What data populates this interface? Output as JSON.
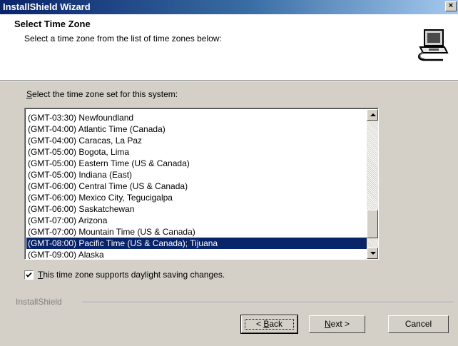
{
  "window": {
    "title": "InstallShield Wizard",
    "close_label": "×"
  },
  "header": {
    "title": "Select Time Zone",
    "subtitle": "Select a time zone from the list of time zones below:",
    "icon": "computer-install-icon"
  },
  "prompt": {
    "accel": "S",
    "rest": "elect the time zone set for this system:"
  },
  "timezones": [
    "(GMT-03:30) Newfoundland",
    "(GMT-04:00) Atlantic Time (Canada)",
    "(GMT-04:00) Caracas, La Paz",
    "(GMT-05:00) Bogota, Lima",
    "(GMT-05:00) Eastern Time (US & Canada)",
    "(GMT-05:00) Indiana (East)",
    "(GMT-06:00) Central Time (US & Canada)",
    "(GMT-06:00) Mexico City, Tegucigalpa",
    "(GMT-06:00) Saskatchewan",
    "(GMT-07:00) Arizona",
    "(GMT-07:00) Mountain Time (US & Canada)",
    "(GMT-08:00) Pacific Time (US & Canada); Tijuana",
    "(GMT-09:00) Alaska"
  ],
  "selected_timezone": "(GMT-08:00) Pacific Time (US & Canada); Tijuana",
  "daylight": {
    "checked": true,
    "accel": "T",
    "rest": "his time zone supports daylight saving changes."
  },
  "brand": "InstallShield",
  "buttons": {
    "back": {
      "prefix": "< ",
      "accel": "B",
      "rest": "ack"
    },
    "next": {
      "accel": "N",
      "rest": "ext >"
    },
    "cancel": "Cancel"
  },
  "colors": {
    "selection": "#0a246a",
    "face": "#d4d0c8",
    "title_gradient_start": "#0a246a"
  }
}
